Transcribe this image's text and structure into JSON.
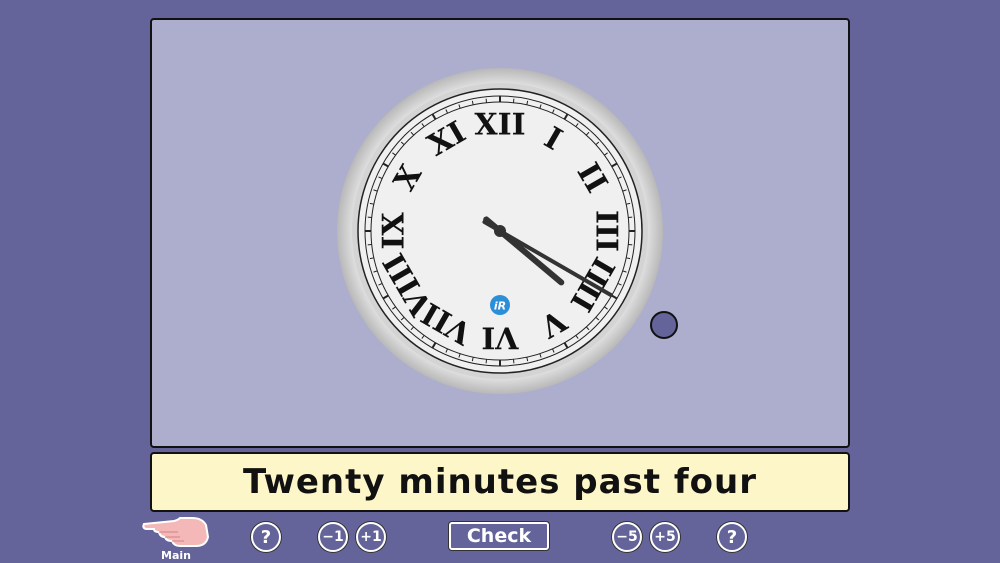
{
  "caption": "Twenty minutes past four",
  "clock": {
    "numerals": [
      "XII",
      "I",
      "II",
      "III",
      "IIII",
      "V",
      "VI",
      "VII",
      "VIII",
      "IX",
      "X",
      "XI"
    ],
    "logo": "iR",
    "hour": 4,
    "minute": 20
  },
  "controls": {
    "main_label": "Main",
    "help_left": "?",
    "minus_one": "−1",
    "plus_one": "+1",
    "check": "Check",
    "minus_five": "−5",
    "plus_five": "+5",
    "help_right": "?"
  },
  "colors": {
    "background": "#64649a",
    "panel": "#adadce",
    "caption_bg": "#fdf6c8",
    "logo": "#2a8fd8"
  },
  "icons": {
    "main": "pointing-hand-icon"
  }
}
